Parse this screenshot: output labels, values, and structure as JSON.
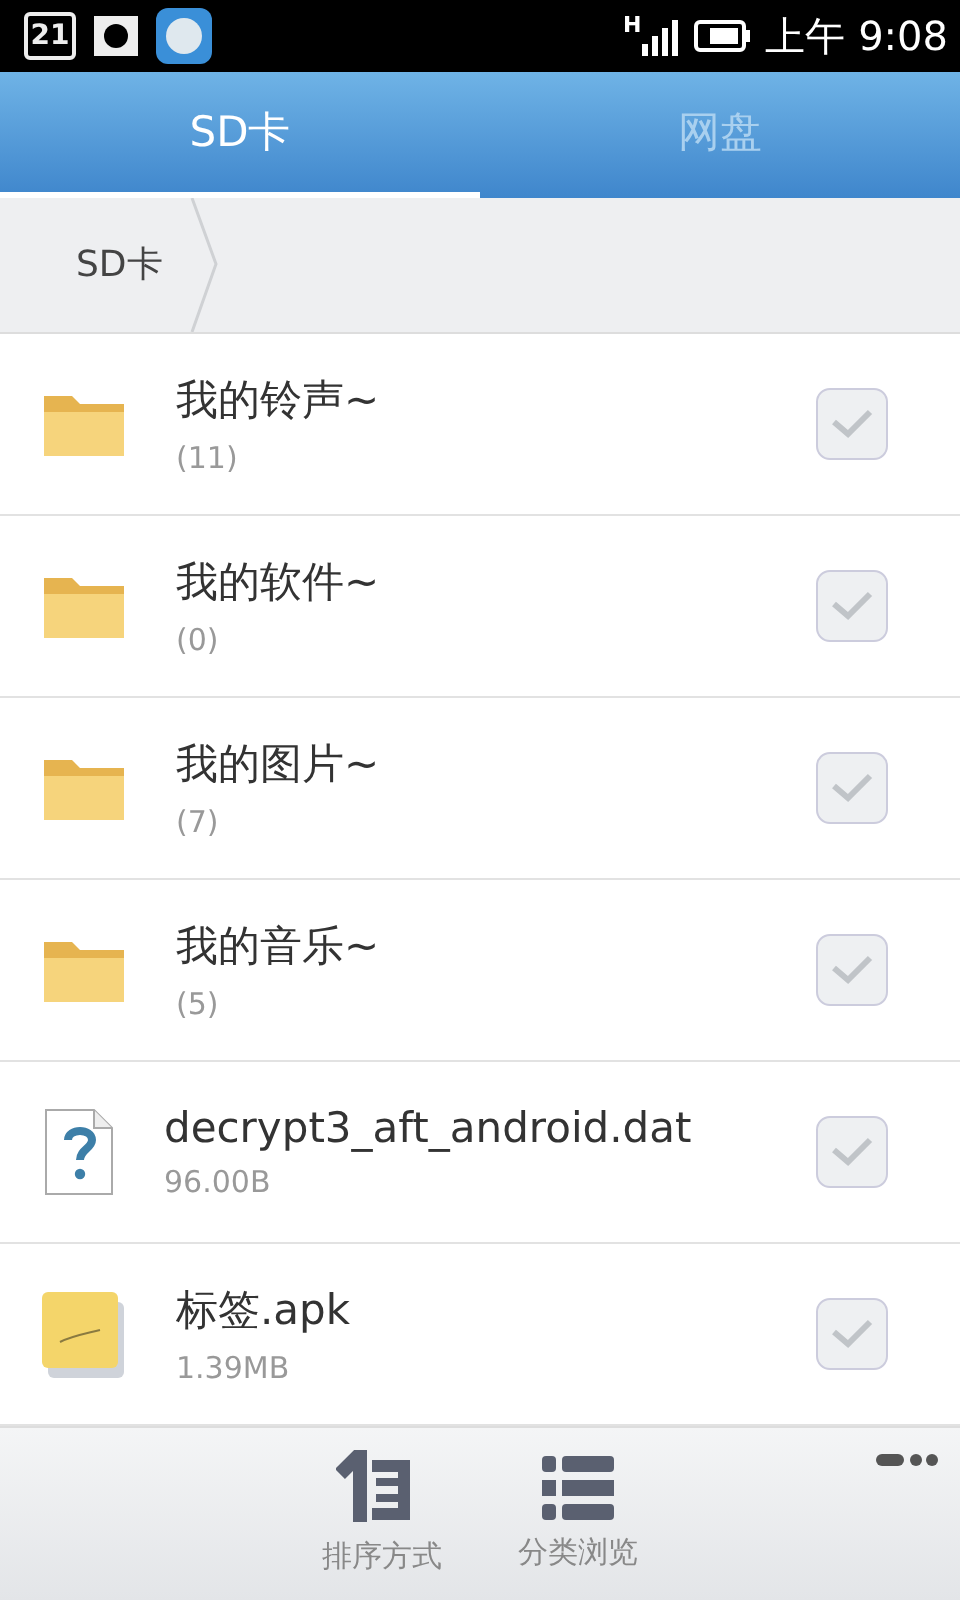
{
  "status_bar": {
    "calendar_day": "21",
    "network_type": "H",
    "time": "上午 9:08"
  },
  "tabs": [
    {
      "label": "SD卡",
      "selected": true
    },
    {
      "label": "网盘",
      "selected": false
    }
  ],
  "breadcrumb": [
    "SD卡"
  ],
  "files": [
    {
      "kind": "folder",
      "name": "我的铃声~",
      "detail": "(11)",
      "checked": false
    },
    {
      "kind": "folder",
      "name": "我的软件~",
      "detail": "(0)",
      "checked": false
    },
    {
      "kind": "folder",
      "name": "我的图片~",
      "detail": "(7)",
      "checked": false
    },
    {
      "kind": "folder",
      "name": "我的音乐~",
      "detail": "(5)",
      "checked": false
    },
    {
      "kind": "unknown",
      "name": "decrypt3_aft_android.dat",
      "detail": "96.00B",
      "checked": false
    },
    {
      "kind": "note",
      "name": "标签.apk",
      "detail": "1.39MB",
      "checked": false
    }
  ],
  "toolbar": [
    {
      "kind": "sort",
      "label": "排序方式"
    },
    {
      "kind": "category",
      "label": "分类浏览"
    }
  ]
}
